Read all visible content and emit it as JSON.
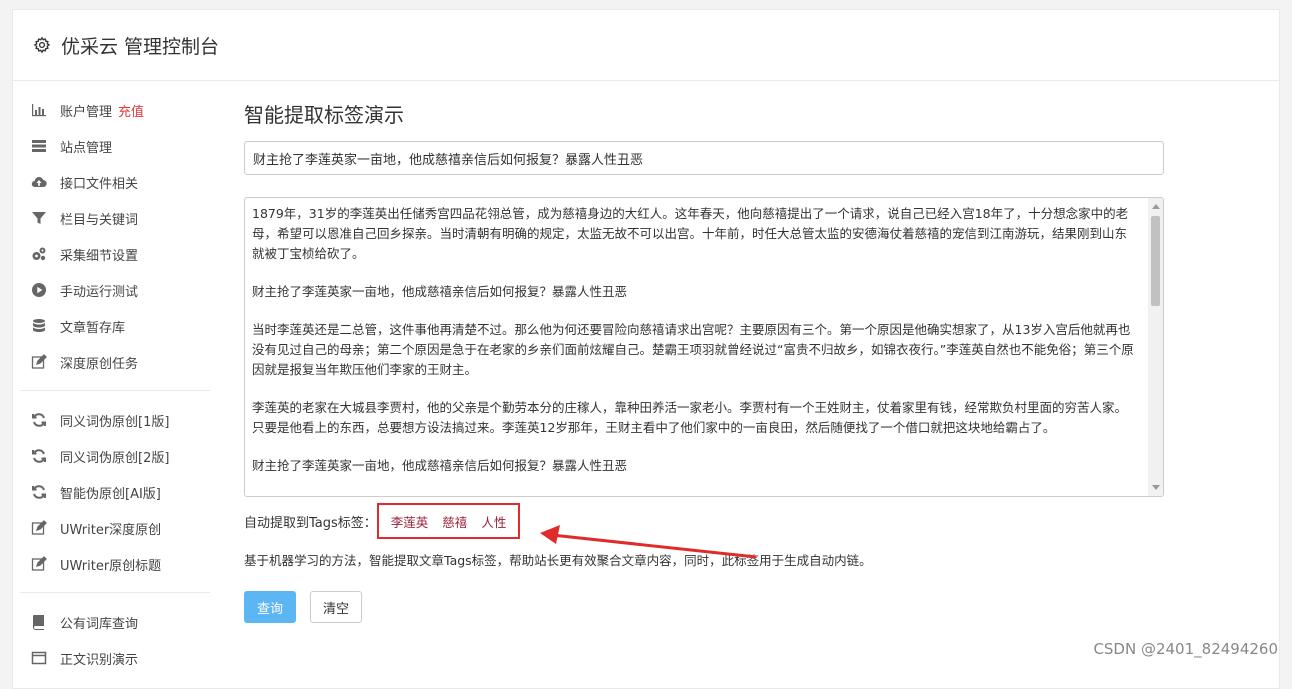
{
  "header": {
    "title": "优采云 管理控制台"
  },
  "sidebar": {
    "group1": [
      {
        "label": "账户管理",
        "badge": "充值",
        "icon": "bar-chart-icon"
      },
      {
        "label": "站点管理",
        "icon": "server-icon"
      },
      {
        "label": "接口文件相关",
        "icon": "cloud-upload-icon"
      },
      {
        "label": "栏目与关键词",
        "icon": "filter-icon"
      },
      {
        "label": "采集细节设置",
        "icon": "gears-icon"
      },
      {
        "label": "手动运行测试",
        "icon": "play-circle-icon"
      },
      {
        "label": "文章暂存库",
        "icon": "database-icon"
      },
      {
        "label": "深度原创任务",
        "icon": "edit-icon"
      }
    ],
    "group2": [
      {
        "label": "同义词伪原创[1版]",
        "icon": "refresh-icon"
      },
      {
        "label": "同义词伪原创[2版]",
        "icon": "refresh-icon"
      },
      {
        "label": "智能伪原创[AI版]",
        "icon": "refresh-icon"
      },
      {
        "label": "UWriter深度原创",
        "icon": "edit-icon"
      },
      {
        "label": "UWriter原创标题",
        "icon": "edit-icon"
      }
    ],
    "group3": [
      {
        "label": "公有词库查询",
        "icon": "book-icon"
      },
      {
        "label": "正文识别演示",
        "icon": "window-icon"
      }
    ]
  },
  "main": {
    "heading": "智能提取标签演示",
    "title_value": "财主抢了李莲英家一亩地，他成慈禧亲信后如何报复？暴露人性丑恶",
    "paragraphs": [
      "1879年，31岁的李莲英出任储秀宫四品花翎总管，成为慈禧身边的大红人。这年春天，他向慈禧提出了一个请求，说自己已经入宫18年了，十分想念家中的老母，希望可以恩准自己回乡探亲。当时清朝有明确的规定，太监无故不可以出宫。十年前，时任大总管太监的安德海仗着慈禧的宠信到江南游玩，结果刚到山东就被丁宝桢给砍了。",
      "财主抢了李莲英家一亩地，他成慈禧亲信后如何报复？暴露人性丑恶",
      "当时李莲英还是二总管，这件事他再清楚不过。那么他为何还要冒险向慈禧请求出宫呢？主要原因有三个。第一个原因是他确实想家了，从13岁入宫后他就再也没有见过自己的母亲；第二个原因是急于在老家的乡亲们面前炫耀自己。楚霸王项羽就曾经说过“富贵不归故乡，如锦衣夜行。”李莲英自然也不能免俗；第三个原因就是报复当年欺压他们李家的王财主。",
      "李莲英的老家在大城县李贾村，他的父亲是个勤劳本分的庄稼人，靠种田养活一家老小。李贾村有一个王姓财主，仗着家里有钱，经常欺负村里面的穷苦人家。只要是他看上的东西，总要想方设法搞过来。李莲英12岁那年，王财主看中了他们家中的一亩良田，然后随便找了一个借口就把这块地给霸占了。",
      "财主抢了李莲英家一亩地，他成慈禧亲信后如何报复？暴露人性丑恶"
    ],
    "tags_label": "自动提取到Tags标签：",
    "tags": [
      "李莲英",
      "慈禧",
      "人性"
    ],
    "description": "基于机器学习的方法，智能提取文章Tags标签，帮助站长更有效聚合文章内容，同时，此标签用于生成自动内链。",
    "query_button": "查询",
    "clear_button": "清空"
  },
  "watermark": "CSDN @2401_82494260",
  "colors": {
    "accent": "#5bb6f3",
    "badge": "#e4393c",
    "tag": "#9c1f3a",
    "highlight": "#e02b2b"
  }
}
